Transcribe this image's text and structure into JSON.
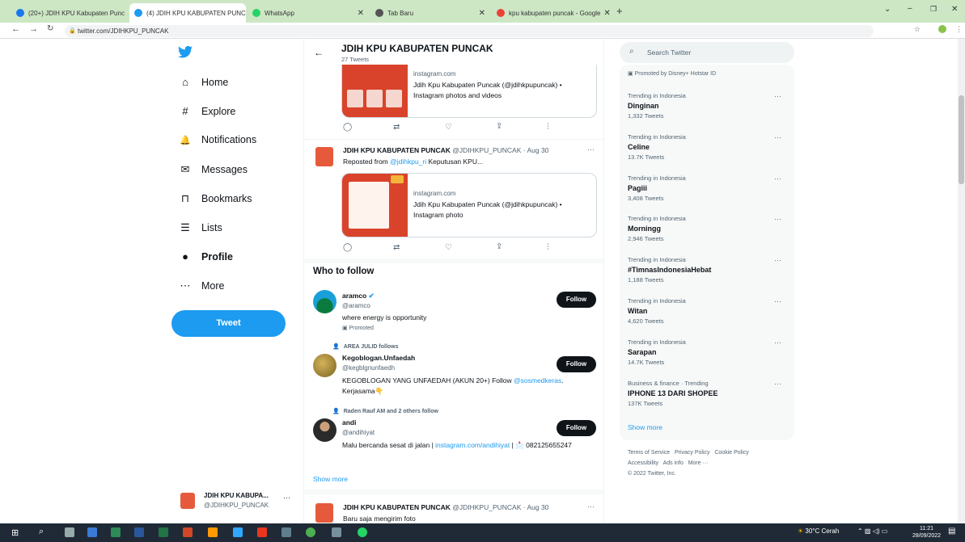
{
  "browser": {
    "tabs": [
      {
        "label": "(20+) JDIH KPU Kabupaten Punc",
        "color": "#1877f2"
      },
      {
        "label": "(4) JDIH KPU KABUPATEN PUNCAK",
        "color": "#1d9bf0"
      },
      {
        "label": "WhatsApp",
        "color": "#25d366"
      },
      {
        "label": "Tab Baru",
        "color": "#555555"
      },
      {
        "label": "kpu kabupaten puncak - Google",
        "color": "#ea4335"
      }
    ],
    "url": "twitter.com/JDIHKPU_PUNCAK",
    "window_controls": {
      "minimize": "–",
      "restore": "❐",
      "close": "✕",
      "dropdown": "⌄"
    }
  },
  "sidebar": {
    "items": [
      {
        "label": "Home",
        "icon": "⌂"
      },
      {
        "label": "Explore",
        "icon": "#"
      },
      {
        "label": "Notifications",
        "icon": "🔔"
      },
      {
        "label": "Messages",
        "icon": "✉"
      },
      {
        "label": "Bookmarks",
        "icon": "⊓"
      },
      {
        "label": "Lists",
        "icon": "☰"
      },
      {
        "label": "Profile",
        "icon": "●"
      },
      {
        "label": "More",
        "icon": "⋯"
      }
    ],
    "tweet_button": "Tweet",
    "account": {
      "name": "JDIH KPU KABUPA...",
      "handle": "@JDIHKPU_PUNCAK"
    }
  },
  "header": {
    "title": "JDIH KPU KABUPATEN PUNCAK",
    "count": "27 Tweets"
  },
  "tweets": [
    {
      "card": {
        "domain": "instagram.com",
        "title": "Jdih Kpu Kabupaten Puncak (@jdihkpupuncak) •",
        "desc": "Instagram photos and videos"
      }
    },
    {
      "name": "JDIH KPU KABUPATEN PUNCAK",
      "meta": "@JDIHKPU_PUNCAK · Aug 30",
      "repost_prefix": "Reposted from ",
      "repost_link": "@jdihkpu_ri",
      "repost_suffix": " Keputusan KPU...",
      "card": {
        "domain": "instagram.com",
        "title": "Jdih Kpu Kabupaten Puncak (@jdihkpupuncak) •",
        "desc": "Instagram photo"
      }
    }
  ],
  "who_to_follow": {
    "title": "Who to follow",
    "follow_label": "Follow",
    "show_more": "Show more",
    "users": [
      {
        "name": "aramco",
        "handle": "@aramco",
        "bio": "where energy is opportunity",
        "promoted": "Promoted"
      },
      {
        "context": "AREA JULID follows",
        "name": "Kegoblogan.Unfaedah",
        "handle": "@kegblgnunfaedh",
        "bio": "KEGOBLOGAN YANG UNFAEDAH (AKUN 20+) Follow ",
        "bio_link": "@sosmedkeras",
        "bio2": ". Kerjasama👇"
      },
      {
        "context": "Raden Rauf AM and 2 others follow",
        "name": "andi",
        "handle": "@andihiyat",
        "bio": "Malu bercanda sesat di jalan | ",
        "bio_link": "instagram.com/andihiyat",
        "bio2": " | 📩 082125655247"
      }
    ]
  },
  "last_tweet": {
    "name": "JDIH KPU KABUPATEN PUNCAK",
    "meta": "@JDIHKPU_PUNCAK · Aug 30",
    "text": "Baru saja mengirim foto"
  },
  "search": {
    "placeholder": "Search Twitter"
  },
  "promoted_note": "Promoted by Disney+ Hotstar ID",
  "trends": [
    {
      "cat": "Trending in Indonesia",
      "name": "Dinginan",
      "count": "1,332 Tweets"
    },
    {
      "cat": "Trending in Indonesia",
      "name": "Celine",
      "count": "13.7K Tweets"
    },
    {
      "cat": "Trending in Indonesia",
      "name": "Pagiii",
      "count": "3,408 Tweets"
    },
    {
      "cat": "Trending in Indonesia",
      "name": "Morningg",
      "count": "2,946 Tweets"
    },
    {
      "cat": "Trending in Indonesia",
      "name": "#TimnasIndonesiaHebat",
      "count": "1,188 Tweets"
    },
    {
      "cat": "Trending in Indonesia",
      "name": "Witan",
      "count": "4,620 Tweets"
    },
    {
      "cat": "Trending in Indonesia",
      "name": "Sarapan",
      "count": "14.7K Tweets"
    },
    {
      "cat": "Business & finance · Trending",
      "name": "IPHONE 13 DARI SHOPEE",
      "count": "137K Tweets"
    }
  ],
  "trends_show_more": "Show more",
  "footer": {
    "line1": "Terms of Service   Privacy Policy   Cookie Policy",
    "line2": "Accessibility   Ads info   More ···",
    "line3": "© 2022 Twitter, Inc."
  },
  "taskbar": {
    "weather": "30°C Cerah",
    "time": "11:21",
    "date": "28/09/2022"
  }
}
